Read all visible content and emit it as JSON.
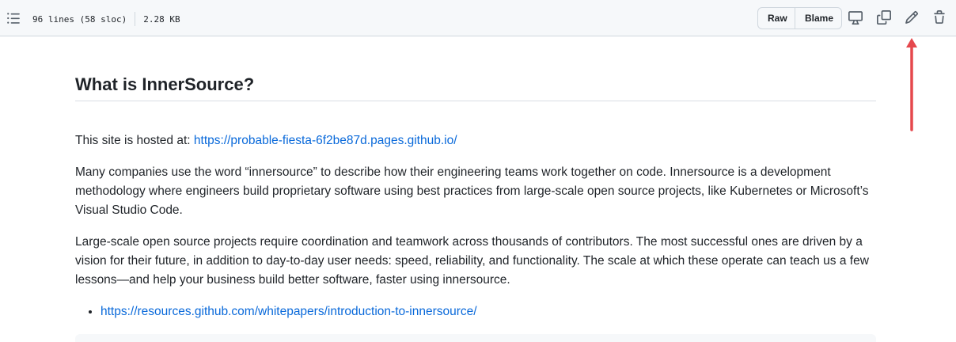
{
  "toolbar": {
    "line_info": "96 lines (58 sloc)",
    "size": "2.28 KB",
    "raw_label": "Raw",
    "blame_label": "Blame"
  },
  "colors": {
    "accent_link": "#0969da",
    "annotation_arrow": "#e5484d"
  },
  "icons": [
    "list-unordered-icon",
    "desktop-icon",
    "copy-icon",
    "pencil-icon",
    "trash-icon"
  ],
  "article": {
    "heading": "What is InnerSource?",
    "hosted_prefix": "This site is hosted at: ",
    "hosted_link": "https://probable-fiesta-6f2be87d.pages.github.io/",
    "para1": "Many companies use the word “innersource” to describe how their engineering teams work together on code. Innersource is a development methodology where engineers build proprietary software using best practices from large-scale open source projects, like Kubernetes or Microsoft’s Visual Studio Code.",
    "para2": "Large-scale open source projects require coordination and teamwork across thousands of contributors. The most successful ones are driven by a vision for their future, in addition to day-to-day user needs: speed, reliability, and functionality. The scale at which these operate can teach us a few lessons—and help your business build better software, faster using innersource.",
    "list": [
      "https://resources.github.com/whitepapers/introduction-to-innersource/"
    ]
  }
}
